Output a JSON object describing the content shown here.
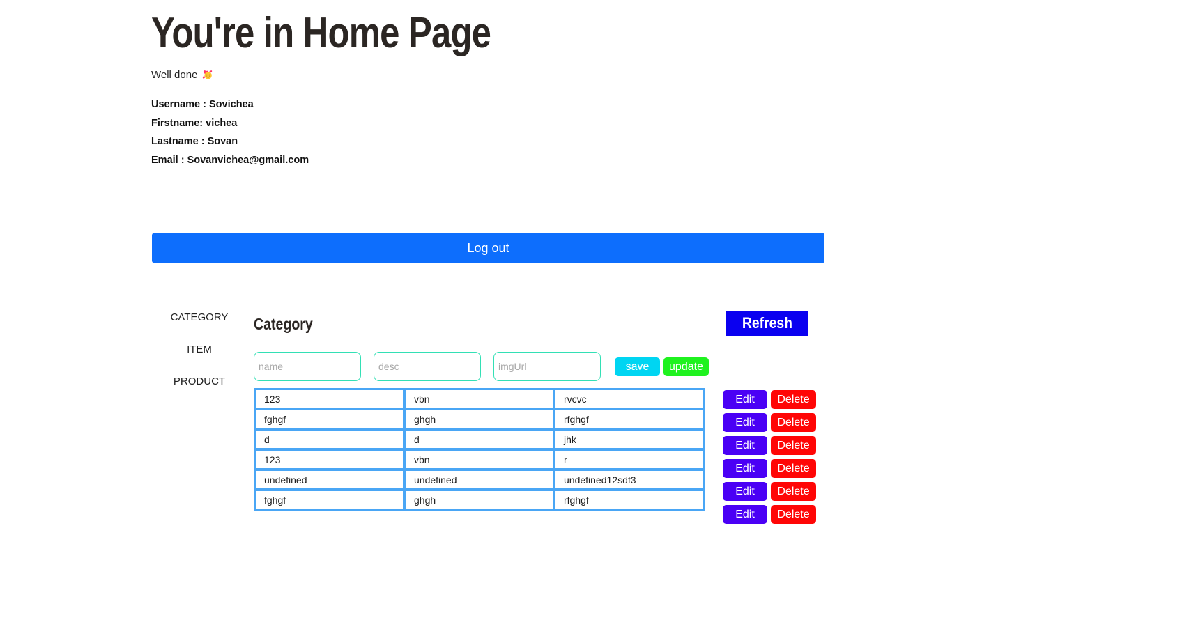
{
  "header": {
    "title": "You're in Home Page",
    "subtitle": "Well done",
    "subtitle_icon": "heart-face-emoji-icon"
  },
  "profile": {
    "username": "Username : Sovichea",
    "firstname": "Firstname: vichea",
    "lastname": "Lastname : Sovan",
    "email": "Email : Sovanvichea@gmail.com"
  },
  "logout_label": "Log out",
  "sidebar": {
    "items": [
      {
        "label": "CATEGORY"
      },
      {
        "label": "ITEM"
      },
      {
        "label": "PRODUCT"
      }
    ]
  },
  "category": {
    "title": "Category",
    "refresh_label": "Refresh",
    "form": {
      "name_placeholder": "name",
      "desc_placeholder": "desc",
      "img_placeholder": "imgUrl",
      "name_value": "",
      "desc_value": "",
      "img_value": "",
      "save_label": "save",
      "update_label": "update"
    },
    "rows": [
      {
        "name": "123",
        "desc": "vbn",
        "img": "rvcvc"
      },
      {
        "name": "fghgf",
        "desc": "ghgh",
        "img": "rfghgf"
      },
      {
        "name": "d",
        "desc": "d",
        "img": "jhk"
      },
      {
        "name": "123",
        "desc": "vbn",
        "img": "r"
      },
      {
        "name": "undefined",
        "desc": "undefined",
        "img": "undefined12sdf3"
      },
      {
        "name": "fghgf",
        "desc": "ghgh",
        "img": "rfghgf"
      }
    ],
    "edit_label": "Edit",
    "delete_label": "Delete"
  },
  "colors": {
    "primary": "#0d6efd",
    "refresh": "#0a00f0",
    "save": "#00d5f2",
    "update": "#1ff21f",
    "edit": "#4a00f5",
    "delete": "#ff0606",
    "input_border": "#33e0b5",
    "table_border": "#4aa6f5"
  }
}
